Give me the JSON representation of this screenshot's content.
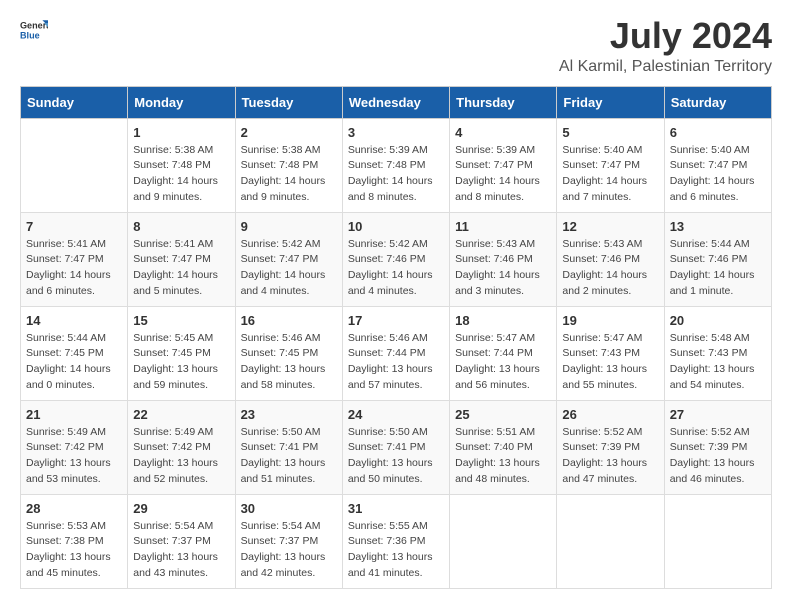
{
  "logo": {
    "general": "General",
    "blue": "Blue"
  },
  "title": "July 2024",
  "subtitle": "Al Karmil, Palestinian Territory",
  "headers": [
    "Sunday",
    "Monday",
    "Tuesday",
    "Wednesday",
    "Thursday",
    "Friday",
    "Saturday"
  ],
  "weeks": [
    [
      {
        "day": "",
        "content": ""
      },
      {
        "day": "1",
        "content": "Sunrise: 5:38 AM\nSunset: 7:48 PM\nDaylight: 14 hours\nand 9 minutes."
      },
      {
        "day": "2",
        "content": "Sunrise: 5:38 AM\nSunset: 7:48 PM\nDaylight: 14 hours\nand 9 minutes."
      },
      {
        "day": "3",
        "content": "Sunrise: 5:39 AM\nSunset: 7:48 PM\nDaylight: 14 hours\nand 8 minutes."
      },
      {
        "day": "4",
        "content": "Sunrise: 5:39 AM\nSunset: 7:47 PM\nDaylight: 14 hours\nand 8 minutes."
      },
      {
        "day": "5",
        "content": "Sunrise: 5:40 AM\nSunset: 7:47 PM\nDaylight: 14 hours\nand 7 minutes."
      },
      {
        "day": "6",
        "content": "Sunrise: 5:40 AM\nSunset: 7:47 PM\nDaylight: 14 hours\nand 6 minutes."
      }
    ],
    [
      {
        "day": "7",
        "content": "Sunrise: 5:41 AM\nSunset: 7:47 PM\nDaylight: 14 hours\nand 6 minutes."
      },
      {
        "day": "8",
        "content": "Sunrise: 5:41 AM\nSunset: 7:47 PM\nDaylight: 14 hours\nand 5 minutes."
      },
      {
        "day": "9",
        "content": "Sunrise: 5:42 AM\nSunset: 7:47 PM\nDaylight: 14 hours\nand 4 minutes."
      },
      {
        "day": "10",
        "content": "Sunrise: 5:42 AM\nSunset: 7:46 PM\nDaylight: 14 hours\nand 4 minutes."
      },
      {
        "day": "11",
        "content": "Sunrise: 5:43 AM\nSunset: 7:46 PM\nDaylight: 14 hours\nand 3 minutes."
      },
      {
        "day": "12",
        "content": "Sunrise: 5:43 AM\nSunset: 7:46 PM\nDaylight: 14 hours\nand 2 minutes."
      },
      {
        "day": "13",
        "content": "Sunrise: 5:44 AM\nSunset: 7:46 PM\nDaylight: 14 hours\nand 1 minute."
      }
    ],
    [
      {
        "day": "14",
        "content": "Sunrise: 5:44 AM\nSunset: 7:45 PM\nDaylight: 14 hours\nand 0 minutes."
      },
      {
        "day": "15",
        "content": "Sunrise: 5:45 AM\nSunset: 7:45 PM\nDaylight: 13 hours\nand 59 minutes."
      },
      {
        "day": "16",
        "content": "Sunrise: 5:46 AM\nSunset: 7:45 PM\nDaylight: 13 hours\nand 58 minutes."
      },
      {
        "day": "17",
        "content": "Sunrise: 5:46 AM\nSunset: 7:44 PM\nDaylight: 13 hours\nand 57 minutes."
      },
      {
        "day": "18",
        "content": "Sunrise: 5:47 AM\nSunset: 7:44 PM\nDaylight: 13 hours\nand 56 minutes."
      },
      {
        "day": "19",
        "content": "Sunrise: 5:47 AM\nSunset: 7:43 PM\nDaylight: 13 hours\nand 55 minutes."
      },
      {
        "day": "20",
        "content": "Sunrise: 5:48 AM\nSunset: 7:43 PM\nDaylight: 13 hours\nand 54 minutes."
      }
    ],
    [
      {
        "day": "21",
        "content": "Sunrise: 5:49 AM\nSunset: 7:42 PM\nDaylight: 13 hours\nand 53 minutes."
      },
      {
        "day": "22",
        "content": "Sunrise: 5:49 AM\nSunset: 7:42 PM\nDaylight: 13 hours\nand 52 minutes."
      },
      {
        "day": "23",
        "content": "Sunrise: 5:50 AM\nSunset: 7:41 PM\nDaylight: 13 hours\nand 51 minutes."
      },
      {
        "day": "24",
        "content": "Sunrise: 5:50 AM\nSunset: 7:41 PM\nDaylight: 13 hours\nand 50 minutes."
      },
      {
        "day": "25",
        "content": "Sunrise: 5:51 AM\nSunset: 7:40 PM\nDaylight: 13 hours\nand 48 minutes."
      },
      {
        "day": "26",
        "content": "Sunrise: 5:52 AM\nSunset: 7:39 PM\nDaylight: 13 hours\nand 47 minutes."
      },
      {
        "day": "27",
        "content": "Sunrise: 5:52 AM\nSunset: 7:39 PM\nDaylight: 13 hours\nand 46 minutes."
      }
    ],
    [
      {
        "day": "28",
        "content": "Sunrise: 5:53 AM\nSunset: 7:38 PM\nDaylight: 13 hours\nand 45 minutes."
      },
      {
        "day": "29",
        "content": "Sunrise: 5:54 AM\nSunset: 7:37 PM\nDaylight: 13 hours\nand 43 minutes."
      },
      {
        "day": "30",
        "content": "Sunrise: 5:54 AM\nSunset: 7:37 PM\nDaylight: 13 hours\nand 42 minutes."
      },
      {
        "day": "31",
        "content": "Sunrise: 5:55 AM\nSunset: 7:36 PM\nDaylight: 13 hours\nand 41 minutes."
      },
      {
        "day": "",
        "content": ""
      },
      {
        "day": "",
        "content": ""
      },
      {
        "day": "",
        "content": ""
      }
    ]
  ]
}
